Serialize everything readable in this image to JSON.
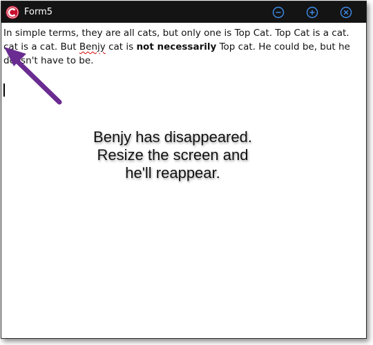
{
  "window": {
    "title": "Form5",
    "app_icon": "c-logo-icon",
    "controls": [
      "minimize-icon",
      "maximize-icon",
      "close-icon"
    ]
  },
  "editor": {
    "line1": "In simple terms, they are all cats, but only one is Top Cat. Top Cat is a cat.",
    "line2_a": " cat is a cat. But ",
    "line2_misspelled": "Benjy",
    "line2_b": " cat is ",
    "line2_bold": "not necessarily",
    "line2_c": " Top cat. He could be, but he",
    "line3": "doesn't have to be."
  },
  "callout": {
    "line1": "Benjy has disappeared.",
    "line2": "Resize the screen and",
    "line3": "he'll reappear."
  },
  "colors": {
    "titlebar": "#141414",
    "control_accent": "#3f8ff0",
    "app_icon_red": "#c8102e",
    "arrow": "#6a2c91",
    "spellcheck": "#d40000"
  }
}
